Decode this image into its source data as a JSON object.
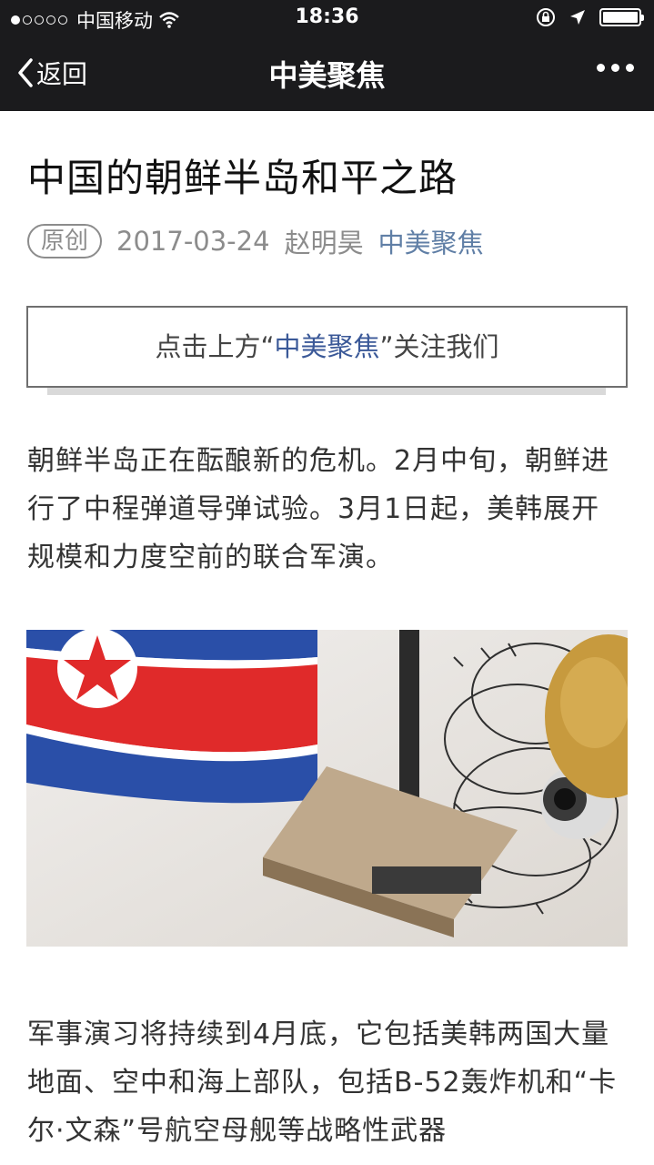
{
  "status_bar": {
    "carrier": "中国移动",
    "time": "18:36"
  },
  "nav": {
    "back_label": "返回",
    "title": "中美聚焦"
  },
  "article": {
    "title": "中国的朝鲜半岛和平之路",
    "badge": "原创",
    "date": "2017-03-24",
    "author": "赵明昊",
    "account": "中美聚焦",
    "follow": {
      "prefix": "点击上方“",
      "highlight": "中美聚焦",
      "suffix": "”关注我们"
    },
    "paragraph1": "朝鲜半岛正在酝酿新的危机。2月中旬，朝鲜进行了中程弹道导弹试验。3月1日起，美韩展开规模和力度空前的联合军演。",
    "paragraph2": "军事演习将持续到4月底，它包括美韩两国大量地面、空中和海上部队，包括B-52轰炸机和“卡尔·文森”号航空母舰等战略性武器"
  },
  "colors": {
    "bar_bg": "#1b1b1d",
    "link_blue": "#607fa6",
    "flag_red": "#e02a2a",
    "flag_blue": "#2a4fa8"
  }
}
